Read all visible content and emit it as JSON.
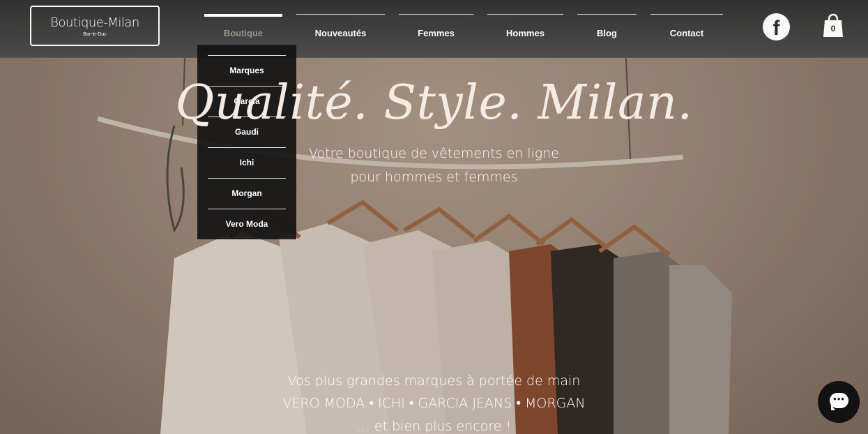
{
  "header": {
    "logo_title": "Boutique-Milan",
    "logo_subtitle": "Bar-le-Duc",
    "nav": [
      {
        "label": "Boutique",
        "active": true
      },
      {
        "label": "Nouveautés"
      },
      {
        "label": "Femmes"
      },
      {
        "label": "Hommes"
      },
      {
        "label": "Blog"
      },
      {
        "label": "Contact"
      }
    ],
    "social_icon": "facebook-icon",
    "social_glyph": "f",
    "cart_icon": "shopping-bag-icon",
    "cart_count": "0"
  },
  "dropdown": {
    "items": [
      "Marques",
      "Garcia",
      "Gaudi",
      "Ichi",
      "Morgan",
      "Vero Moda"
    ]
  },
  "hero": {
    "headline": "Qualité. Style. Milan.",
    "subtitle_line1": "Votre boutique de vêtements en ligne",
    "subtitle_line2": "pour hommes et femmes",
    "bottom_line1": "Vos plus grandes marques à portée de main",
    "bottom_line2": "VERO MODA • ICHI • GARCIA JEANS • MORGAN",
    "bottom_line3": "… et bien plus encore !"
  },
  "chat": {
    "icon": "chat-bubble-icon",
    "dots": "•••"
  },
  "colors": {
    "header_bg": "#3a3a3a",
    "dropdown_bg": "#141414",
    "active_nav_text": "#9a948c",
    "headline_text": "#f4ece4"
  }
}
